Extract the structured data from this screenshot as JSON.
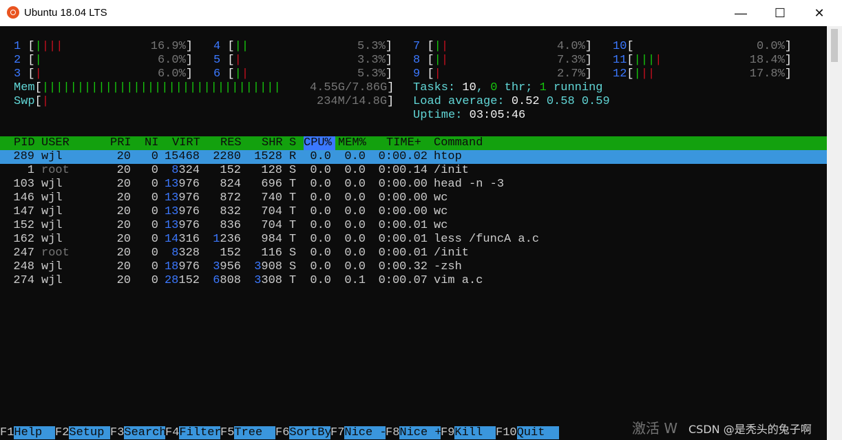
{
  "window": {
    "title": "Ubuntu 18.04 LTS",
    "minimize": "—",
    "maximize": "☐",
    "close": "✕"
  },
  "cpus": [
    {
      "id": "1",
      "pct": "16.9%"
    },
    {
      "id": "2",
      "pct": "6.0%"
    },
    {
      "id": "3",
      "pct": "6.0%"
    },
    {
      "id": "4",
      "pct": "5.3%"
    },
    {
      "id": "5",
      "pct": "3.3%"
    },
    {
      "id": "6",
      "pct": "5.3%"
    },
    {
      "id": "7",
      "pct": "4.0%"
    },
    {
      "id": "8",
      "pct": "7.3%"
    },
    {
      "id": "9",
      "pct": "2.7%"
    },
    {
      "id": "10",
      "pct": "0.0%"
    },
    {
      "id": "11",
      "pct": "18.4%"
    },
    {
      "id": "12",
      "pct": "17.8%"
    }
  ],
  "mem": {
    "label": "Mem",
    "value": "4.55G/7.86G"
  },
  "swp": {
    "label": "Swp",
    "value": "234M/14.8G"
  },
  "tasks": {
    "label": "Tasks: ",
    "count": "10",
    "sep": ", ",
    "thr": "0",
    "thr_label": " thr; ",
    "running": "1",
    "running_label": " running"
  },
  "load": {
    "label": "Load average: ",
    "v1": "0.52",
    "v5": "0.58",
    "v15": "0.59"
  },
  "uptime": {
    "label": "Uptime: ",
    "value": "03:05:46"
  },
  "columns": {
    "pid": "PID",
    "user": "USER",
    "pri": "PRI",
    "ni": "NI",
    "virt": "VIRT",
    "res": "RES",
    "shr": "SHR",
    "s": "S",
    "cpu": "CPU%",
    "mem": "MEM%",
    "time": "TIME+",
    "cmd": "Command"
  },
  "processes": [
    {
      "pid": "289",
      "user": "wjl",
      "pri": "20",
      "ni": "0",
      "virt": "15468",
      "res": "2280",
      "shr": "1528",
      "s": "R",
      "cpu": "0.0",
      "mem": "0.0",
      "time": "0:00.02",
      "cmd": "htop"
    },
    {
      "pid": "1",
      "user": "root",
      "pri": "20",
      "ni": "0",
      "virt": "8324",
      "res": "152",
      "shr": "128",
      "s": "S",
      "cpu": "0.0",
      "mem": "0.0",
      "time": "0:00.14",
      "cmd": "/init"
    },
    {
      "pid": "103",
      "user": "wjl",
      "pri": "20",
      "ni": "0",
      "virt": "13976",
      "res": "824",
      "shr": "696",
      "s": "T",
      "cpu": "0.0",
      "mem": "0.0",
      "time": "0:00.00",
      "cmd": "head -n -3"
    },
    {
      "pid": "146",
      "user": "wjl",
      "pri": "20",
      "ni": "0",
      "virt": "13976",
      "res": "872",
      "shr": "740",
      "s": "T",
      "cpu": "0.0",
      "mem": "0.0",
      "time": "0:00.00",
      "cmd": "wc"
    },
    {
      "pid": "147",
      "user": "wjl",
      "pri": "20",
      "ni": "0",
      "virt": "13976",
      "res": "832",
      "shr": "704",
      "s": "T",
      "cpu": "0.0",
      "mem": "0.0",
      "time": "0:00.00",
      "cmd": "wc"
    },
    {
      "pid": "152",
      "user": "wjl",
      "pri": "20",
      "ni": "0",
      "virt": "13976",
      "res": "836",
      "shr": "704",
      "s": "T",
      "cpu": "0.0",
      "mem": "0.0",
      "time": "0:00.01",
      "cmd": "wc"
    },
    {
      "pid": "162",
      "user": "wjl",
      "pri": "20",
      "ni": "0",
      "virt": "14316",
      "res": "1236",
      "shr": "984",
      "s": "T",
      "cpu": "0.0",
      "mem": "0.0",
      "time": "0:00.01",
      "cmd": "less /funcA a.c"
    },
    {
      "pid": "247",
      "user": "root",
      "pri": "20",
      "ni": "0",
      "virt": "8328",
      "res": "152",
      "shr": "116",
      "s": "S",
      "cpu": "0.0",
      "mem": "0.0",
      "time": "0:00.01",
      "cmd": "/init"
    },
    {
      "pid": "248",
      "user": "wjl",
      "pri": "20",
      "ni": "0",
      "virt": "18976",
      "res": "3956",
      "shr": "3908",
      "s": "S",
      "cpu": "0.0",
      "mem": "0.0",
      "time": "0:00.32",
      "cmd": "-zsh"
    },
    {
      "pid": "274",
      "user": "wjl",
      "pri": "20",
      "ni": "0",
      "virt": "28152",
      "res": "6808",
      "shr": "3308",
      "s": "T",
      "cpu": "0.0",
      "mem": "0.1",
      "time": "0:00.07",
      "cmd": "vim a.c"
    }
  ],
  "fkeys": [
    {
      "key": "F1",
      "label": "Help  "
    },
    {
      "key": "F2",
      "label": "Setup "
    },
    {
      "key": "F3",
      "label": "Search"
    },
    {
      "key": "F4",
      "label": "Filter"
    },
    {
      "key": "F5",
      "label": "Tree  "
    },
    {
      "key": "F6",
      "label": "SortBy"
    },
    {
      "key": "F7",
      "label": "Nice -"
    },
    {
      "key": "F8",
      "label": "Nice +"
    },
    {
      "key": "F9",
      "label": "Kill  "
    },
    {
      "key": "F10",
      "label": "Quit  "
    }
  ],
  "watermark": {
    "text1": "激活 W",
    "text2": "CSDN @是秃头的兔子啊"
  },
  "colors": {
    "terminal_bg": "#0c0c0c",
    "header_green": "#13a10e",
    "selection_blue": "#3a96dd",
    "number_blue": "#3b78ff",
    "label_cyan": "#61d6d6"
  }
}
